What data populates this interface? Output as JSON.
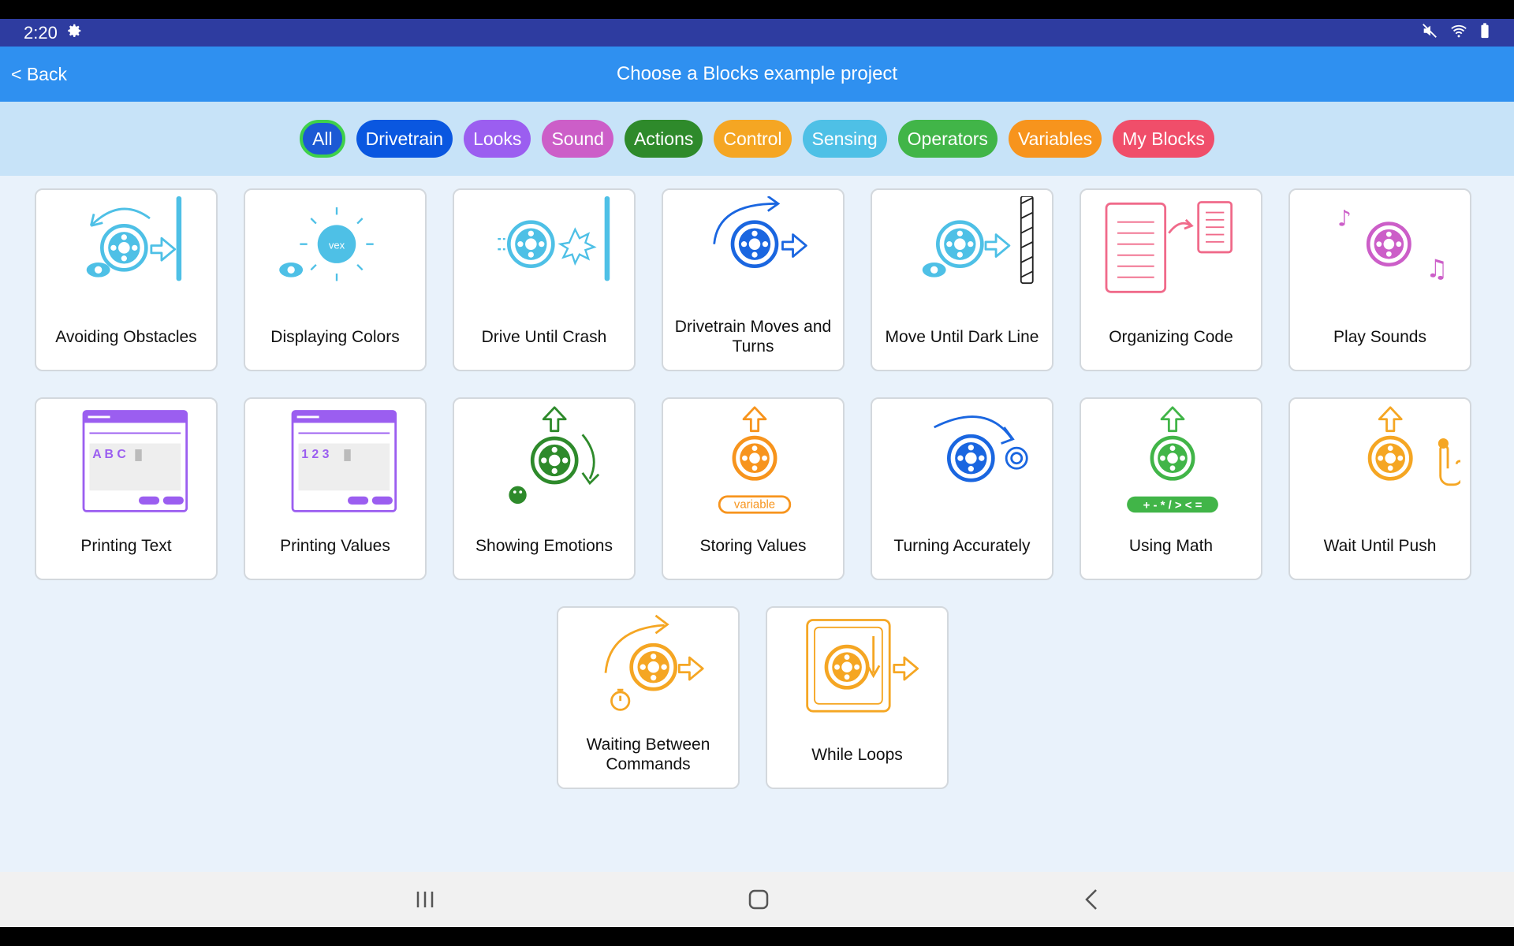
{
  "status": {
    "time": "2:20"
  },
  "header": {
    "back_label": "< Back",
    "title": "Choose a Blocks example project"
  },
  "filters": [
    {
      "label": "All",
      "color": "#1c59d4",
      "selected": true
    },
    {
      "label": "Drivetrain",
      "color": "#0a57e0"
    },
    {
      "label": "Looks",
      "color": "#9b5ef0"
    },
    {
      "label": "Sound",
      "color": "#cc5ec8"
    },
    {
      "label": "Actions",
      "color": "#2e8a2b"
    },
    {
      "label": "Control",
      "color": "#f5a623"
    },
    {
      "label": "Sensing",
      "color": "#4ec0e6"
    },
    {
      "label": "Operators",
      "color": "#41b548"
    },
    {
      "label": "Variables",
      "color": "#f7941d"
    },
    {
      "label": "My Blocks",
      "color": "#f04e6a"
    }
  ],
  "projects": [
    {
      "title": "Avoiding Obstacles",
      "icon": "avoiding-obstacles-icon",
      "color": "#4ec0e6"
    },
    {
      "title": "Displaying Colors",
      "icon": "displaying-colors-icon",
      "color": "#4ec0e6"
    },
    {
      "title": "Drive Until Crash",
      "icon": "drive-until-crash-icon",
      "color": "#4ec0e6"
    },
    {
      "title": "Drivetrain Moves and Turns",
      "icon": "drivetrain-moves-icon",
      "color": "#1a66e0"
    },
    {
      "title": "Move Until Dark Line",
      "icon": "dark-line-icon",
      "color": "#4ec0e6"
    },
    {
      "title": "Organizing Code",
      "icon": "organizing-code-icon",
      "color": "#f06a8a"
    },
    {
      "title": "Play Sounds",
      "icon": "play-sounds-icon",
      "color": "#cc5ec8"
    },
    {
      "title": "Printing Text",
      "icon": "printing-text-icon",
      "color": "#9b5ef0",
      "screen_text": "A B C"
    },
    {
      "title": "Printing Values",
      "icon": "printing-values-icon",
      "color": "#9b5ef0",
      "screen_text": "1 2 3"
    },
    {
      "title": "Showing Emotions",
      "icon": "showing-emotions-icon",
      "color": "#2e8a2b"
    },
    {
      "title": "Storing Values",
      "icon": "storing-values-icon",
      "color": "#f7941d",
      "tag": "variable"
    },
    {
      "title": "Turning Accurately",
      "icon": "turning-accurately-icon",
      "color": "#1a66e0"
    },
    {
      "title": "Using Math",
      "icon": "using-math-icon",
      "color": "#41b548",
      "tag": "+ - * / > < ="
    },
    {
      "title": "Wait Until Push",
      "icon": "wait-until-push-icon",
      "color": "#f5a623"
    },
    {
      "title": "Waiting Between Commands",
      "icon": "waiting-commands-icon",
      "color": "#f5a623"
    },
    {
      "title": "While Loops",
      "icon": "while-loops-icon",
      "color": "#f5a623"
    }
  ]
}
